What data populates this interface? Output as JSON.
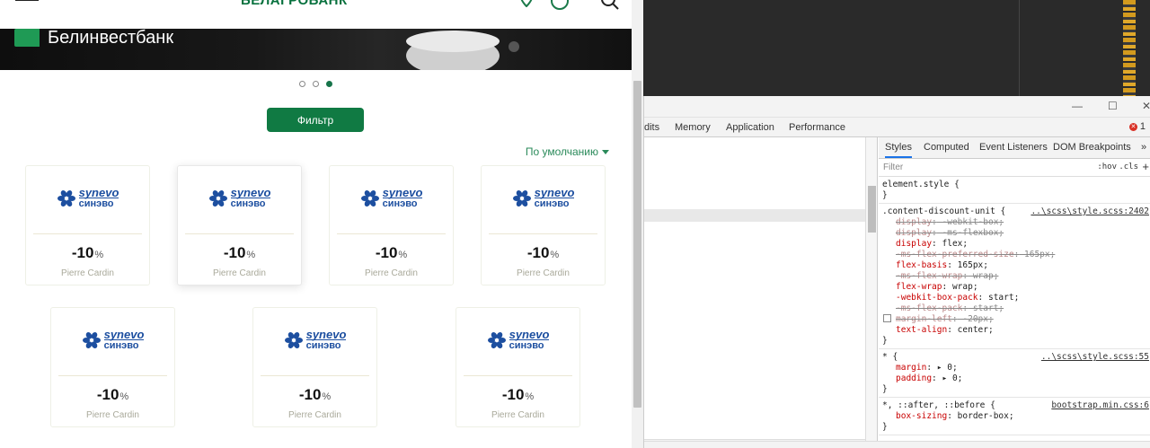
{
  "site": {
    "logo_text": "БЕЛАГРОБАНК",
    "banner_brand": "Белинвестбанк",
    "carousel_dots": 3,
    "filter_label": "Фильтр",
    "sort_label": "По умолчанию"
  },
  "cards": [
    {
      "logo_line1": "synevo",
      "logo_line2": "синэво",
      "discount_sign": "-",
      "discount_value": "10",
      "discount_unit": "%",
      "name": "Pierre Cardin"
    },
    {
      "logo_line1": "synevo",
      "logo_line2": "синэво",
      "discount_sign": "-",
      "discount_value": "10",
      "discount_unit": "%",
      "name": "Pierre Cardin"
    },
    {
      "logo_line1": "synevo",
      "logo_line2": "синэво",
      "discount_sign": "-",
      "discount_value": "10",
      "discount_unit": "%",
      "name": "Pierre Cardin"
    },
    {
      "logo_line1": "synevo",
      "logo_line2": "синэво",
      "discount_sign": "-",
      "discount_value": "10",
      "discount_unit": "%",
      "name": "Pierre Cardin"
    },
    {
      "logo_line1": "synevo",
      "logo_line2": "синэво",
      "discount_sign": "-",
      "discount_value": "10",
      "discount_unit": "%",
      "name": "Pierre Cardin"
    },
    {
      "logo_line1": "synevo",
      "logo_line2": "синэво",
      "discount_sign": "-",
      "discount_value": "10",
      "discount_unit": "%",
      "name": "Pierre Cardin"
    },
    {
      "logo_line1": "synevo",
      "logo_line2": "синэво",
      "discount_sign": "-",
      "discount_value": "10",
      "discount_unit": "%",
      "name": "Pierre Cardin"
    }
  ],
  "devtools": {
    "window_controls": {
      "minimize": "—",
      "maximize": "☐",
      "close": "✕"
    },
    "tabs": [
      "dits",
      "Memory",
      "Application",
      "Performance"
    ],
    "error_count": "1",
    "styles_tabs": [
      "Styles",
      "Computed",
      "Event Listeners",
      "DOM Breakpoints",
      "»"
    ],
    "filter_placeholder": "Filter",
    "hov": ":hov",
    "cls": ".cls",
    "plus": "+",
    "element_style": {
      "selector": "element.style {",
      "close": "}"
    },
    "rule1": {
      "selector": ".content-discount-unit {",
      "source": "..\\scss\\style.scss:2402",
      "decls": [
        {
          "prop": "display",
          "value": " -webkit-box;",
          "struck": true
        },
        {
          "prop": "display",
          "value": " -ms-flexbox;",
          "struck": true
        },
        {
          "prop": "display",
          "value": " flex;",
          "struck": false
        },
        {
          "prop": "-ms-flex-preferred-size",
          "value": " 165px;",
          "struck": true
        },
        {
          "prop": "flex-basis",
          "value": " 165px;",
          "struck": false
        },
        {
          "prop": "-ms-flex-wrap",
          "value": " wrap;",
          "struck": true
        },
        {
          "prop": "flex-wrap",
          "value": " wrap;",
          "struck": false
        },
        {
          "prop": "-webkit-box-pack",
          "value": " start;",
          "struck": false
        },
        {
          "prop": "-ms-flex-pack",
          "value": " start;",
          "struck": true
        },
        {
          "prop": "margin-left",
          "value": " -20px;",
          "struck": true,
          "checkbox": true
        },
        {
          "prop": "text-align",
          "value": " center;",
          "struck": false
        }
      ],
      "close": "}"
    },
    "rule2": {
      "selector": "* {",
      "source": "..\\scss\\style.scss:55",
      "decls": [
        {
          "prop": "margin",
          "value": " ▸ 0;"
        },
        {
          "prop": "padding",
          "value": " ▸ 0;"
        }
      ],
      "close": "}"
    },
    "rule3": {
      "selector": "*, ::after, ::before {",
      "source": "bootstrap.min.css:6",
      "decls": [
        {
          "prop": "box-sizing",
          "value": " border-box;"
        }
      ],
      "close": "}"
    }
  },
  "colors": {
    "brand_green": "#107a43",
    "synevo_blue": "#1d4fa0"
  }
}
